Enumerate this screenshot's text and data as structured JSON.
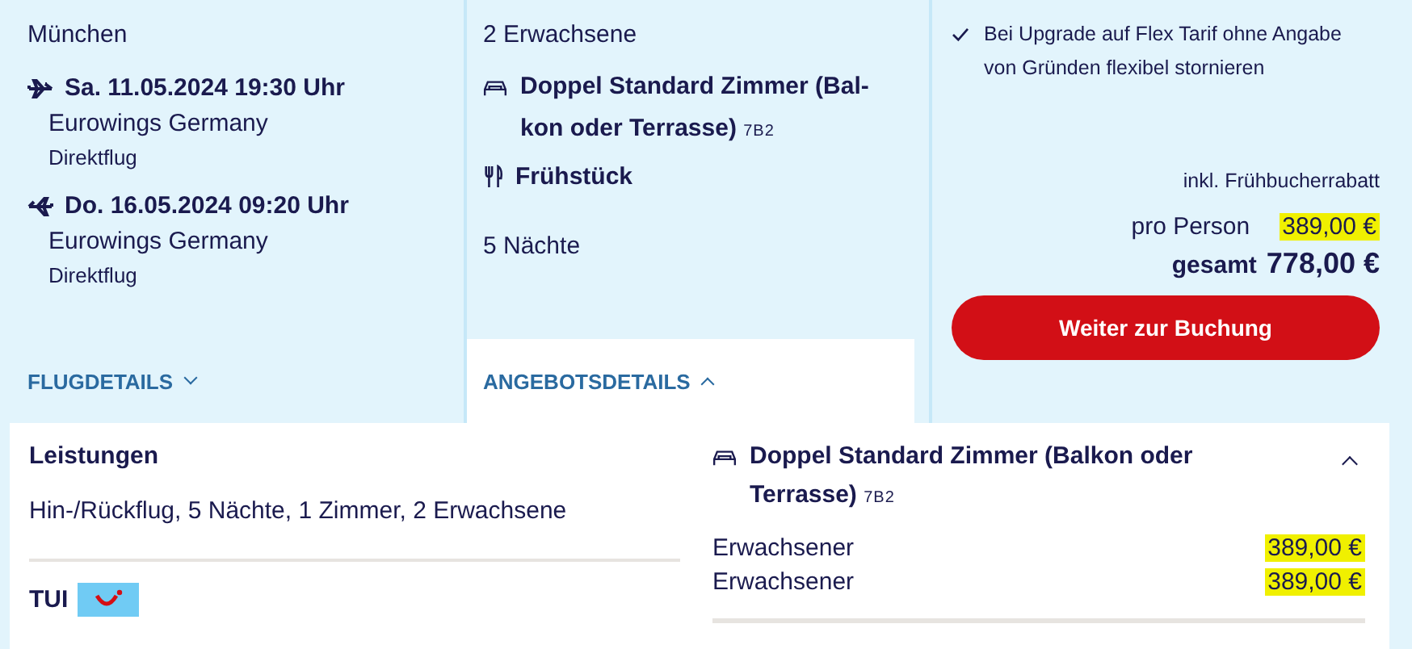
{
  "flight": {
    "origin": "München",
    "legs": [
      {
        "kind": "outbound",
        "date": "Sa. 11.05.2024 19:30 Uhr",
        "airline": "Eurowings Germany",
        "type": "Direktflug"
      },
      {
        "kind": "return",
        "date": "Do. 16.05.2024 09:20 Uhr",
        "airline": "Eurowings Germany",
        "type": "Direktflug"
      }
    ],
    "details_link": {
      "label": "FLUGDETAILS",
      "expanded": false
    }
  },
  "offer": {
    "travellers": "2 Erwachsene",
    "room": "Doppel Standard Zimmer (Bal-kon oder Terrasse)",
    "room_code": "7B2",
    "board": "Frühstück",
    "nights": "5 Nächte",
    "details_link": {
      "label": "ANGEBOTSDETAILS",
      "expanded": true
    }
  },
  "price": {
    "benefit": "Bei Upgrade auf Flex Tarif ohne Angabe von Gründen flexibel stornieren",
    "discount_note": "inkl. Frühbucherrabatt",
    "per_person_label": "pro Person",
    "per_person": {
      "text": "389,00 €",
      "highlighted": true
    },
    "total_label": "gesamt",
    "total": "778,00 €",
    "button": "Weiter zur Buchung"
  },
  "details": {
    "services_title": "Leistungen",
    "services": "Hin-/Rückflug, 5 Nächte, 1 Zimmer, 2 Erwachsene",
    "operator": "TUI",
    "room": "Doppel Standard Zimmer (Balkon oder Terrasse)",
    "room_code": "7B2",
    "room_expanded": true,
    "lines": [
      {
        "label": "Erwachsener",
        "price": "389,00 €",
        "highlighted": true
      },
      {
        "label": "Erwachsener",
        "price": "389,00 €",
        "highlighted": true
      }
    ]
  }
}
